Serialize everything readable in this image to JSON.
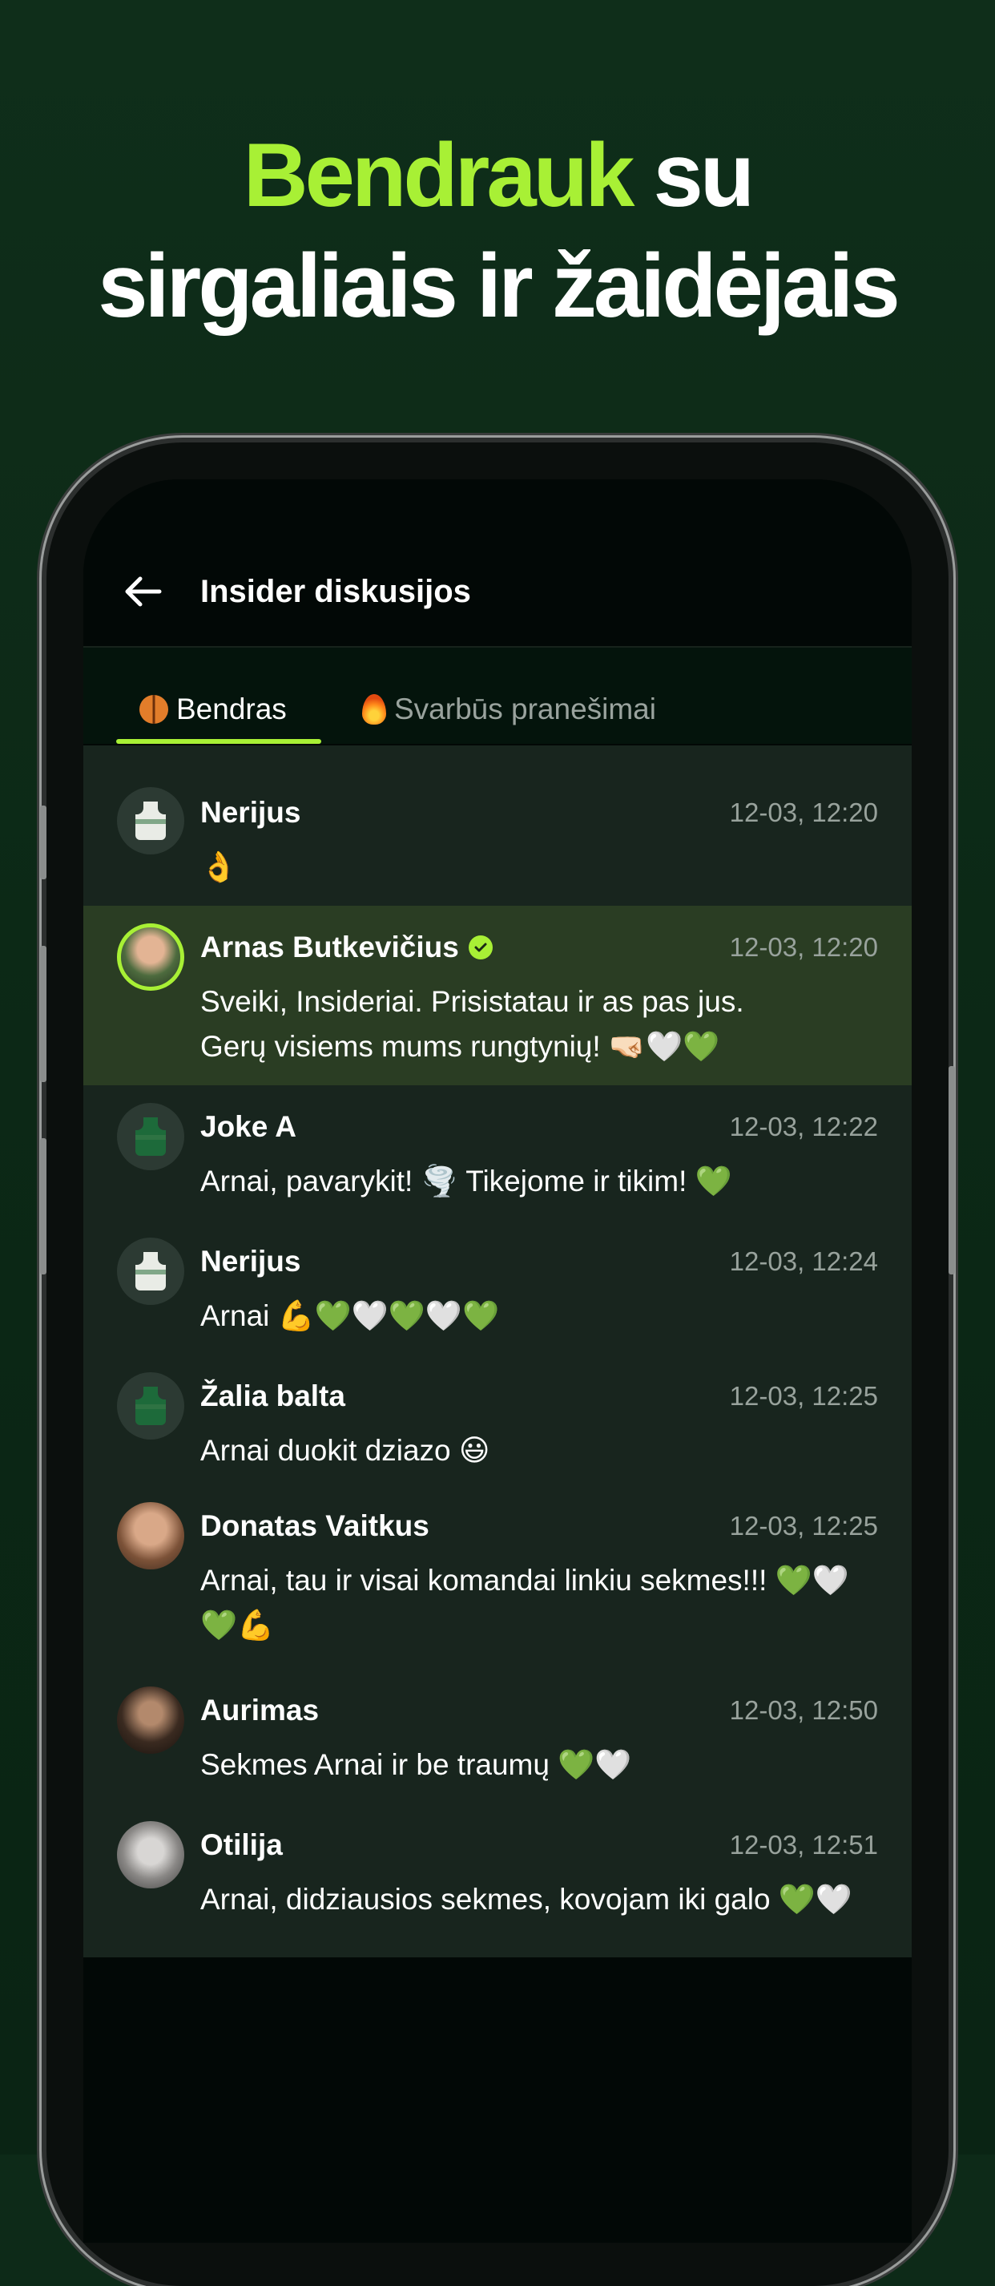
{
  "headline": {
    "accent": "Bendrauk",
    "rest_line1": " su",
    "line2": "sirgaliais ir žaidėjais"
  },
  "colors": {
    "accent": "#a8f035",
    "background": "#0d2a18",
    "feed": "#18251e",
    "highlight": "#2a3d23"
  },
  "topbar": {
    "back_icon": "arrow-left-icon",
    "title": "Insider diskusijos"
  },
  "tabs": [
    {
      "icon": "basketball-emoji",
      "label": "Bendras",
      "active": true
    },
    {
      "icon": "fire-emoji",
      "label": "Svarbūs pranešimai",
      "active": false
    }
  ],
  "messages": [
    {
      "name": "Nerijus",
      "time": "12-03, 12:20",
      "text": "👌",
      "avatar": "jersey-white"
    },
    {
      "name": "Arnas Butkevičius",
      "verified": true,
      "time": "12-03, 12:20",
      "text": "Sveiki, Insideriai. Prisistatau ir as pas jus. Gerų visiems mums rungtynių! 🤜🏻🤍💚",
      "avatar": "photo",
      "highlighted": true
    },
    {
      "name": "Joke A",
      "time": "12-03, 12:22",
      "text": "Arnai, pavarykit! 🌪️ Tikejome ir tikim! 💚",
      "avatar": "jersey-green"
    },
    {
      "name": "Nerijus",
      "time": "12-03, 12:24",
      "text": "Arnai 💪💚🤍💚🤍💚",
      "avatar": "jersey-white"
    },
    {
      "name": "Žalia balta",
      "time": "12-03, 12:25",
      "text": "Arnai duokit dziazo 😃",
      "avatar": "jersey-green"
    },
    {
      "name": "Donatas Vaitkus",
      "time": "12-03, 12:25",
      "text": "Arnai, tau ir visai komandai linkiu sekmes!!! 💚🤍 💚💪",
      "avatar": "photo"
    },
    {
      "name": "Aurimas",
      "time": "12-03, 12:50",
      "text": "Sekmes Arnai ir be traumų 💚🤍",
      "avatar": "photo"
    },
    {
      "name": "Otilija",
      "time": "12-03, 12:51",
      "text": "Arnai, didziausios sekmes, kovojam iki galo 💚🤍",
      "avatar": "photo"
    }
  ]
}
